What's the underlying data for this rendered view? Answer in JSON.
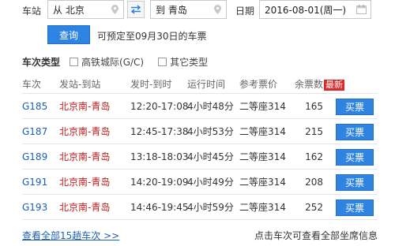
{
  "search": {
    "station_label": "车站",
    "from_value": "从 北京",
    "to_value": "到 青岛",
    "date_label": "日期",
    "date_value": "2016-08-01(周一)",
    "query_button": "查询",
    "hint": "可预定至09月30日的车票"
  },
  "filters": {
    "title": "车次类型",
    "options": [
      {
        "label": "高铁城际(G/C)",
        "checked": false
      },
      {
        "label": "其它类型",
        "checked": false
      }
    ]
  },
  "table": {
    "headers": [
      "车次",
      "发站-到站",
      "发时-到时",
      "运行时间",
      "参考票价",
      "余票数"
    ],
    "badge": "最新",
    "rows": [
      {
        "train": "G185",
        "route": "北京南-青岛",
        "times": "12:20-17:08",
        "duration": "4小时48分",
        "price": "二等座314",
        "seats": "165",
        "action": "买票"
      },
      {
        "train": "G187",
        "route": "北京南-青岛",
        "times": "12:45-17:38",
        "duration": "4小时53分",
        "price": "二等座314",
        "seats": "215",
        "action": "买票"
      },
      {
        "train": "G189",
        "route": "北京南-青岛",
        "times": "13:18-18:03",
        "duration": "4小时45分",
        "price": "二等座314",
        "seats": "162",
        "action": "买票"
      },
      {
        "train": "G191",
        "route": "北京南-青岛",
        "times": "14:20-19:09",
        "duration": "4小时49分",
        "price": "二等座314",
        "seats": "208",
        "action": "买票"
      },
      {
        "train": "G193",
        "route": "北京南-青岛",
        "times": "14:46-19:45",
        "duration": "4小时59分",
        "price": "二等座314",
        "seats": "252",
        "action": "买票"
      }
    ]
  },
  "footer": {
    "more_link": "查看全部15趟车次 >>",
    "note": "点击车次可查看全部坐席信息"
  },
  "colors": {
    "accent": "#2f84e1",
    "route_red": "#c21c1c",
    "train_blue": "#1b5fb0",
    "badge_red": "#d92a2a"
  }
}
